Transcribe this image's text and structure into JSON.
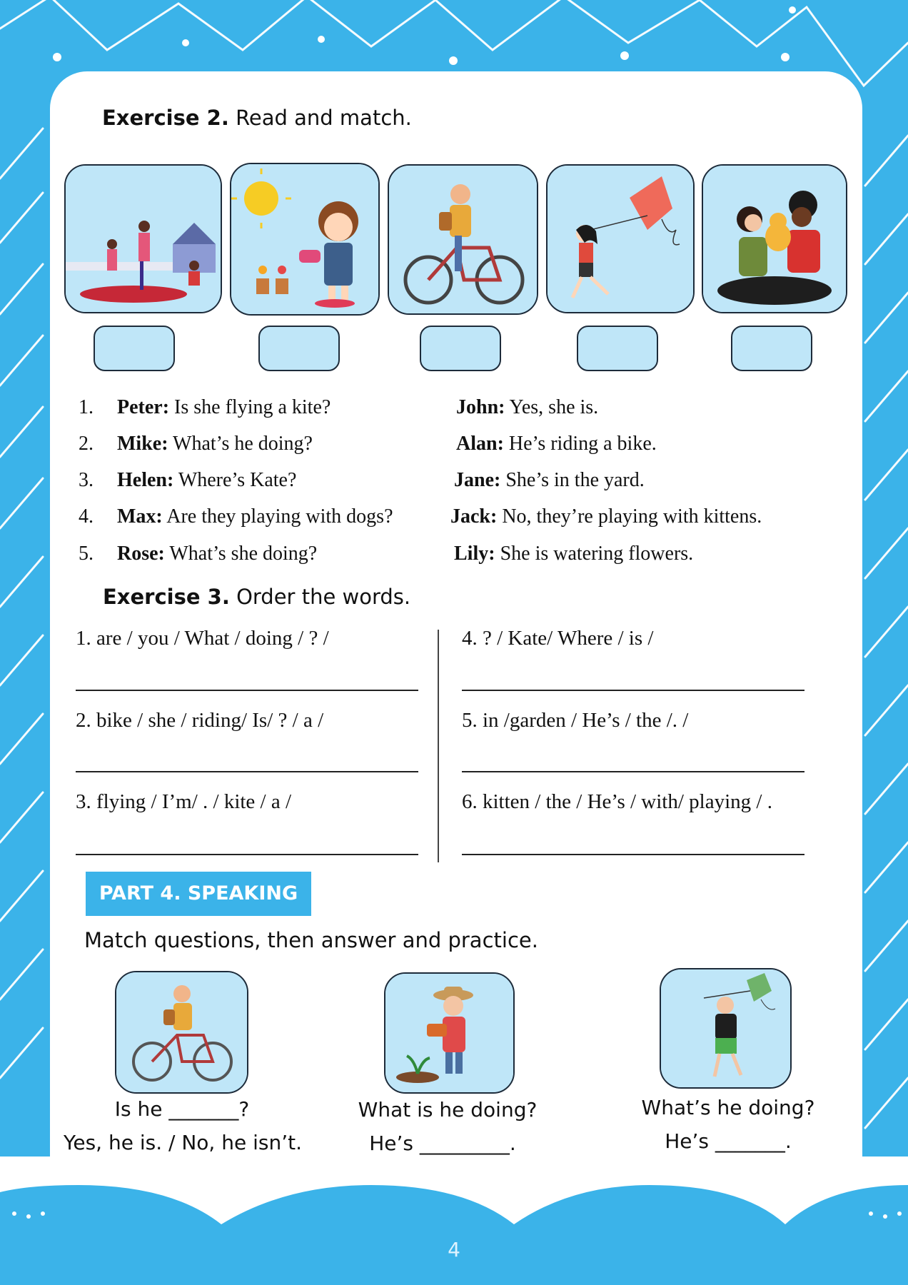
{
  "exercise2": {
    "label": "Exercise 2.",
    "instruction": "Read and match.",
    "pictures": [
      "yoga-family-picture",
      "girl-watering-flowers-picture",
      "man-riding-bike-picture",
      "girl-flying-kite-picture",
      "girls-with-kitten-picture"
    ],
    "dialogues": [
      {
        "num": "1.",
        "q_name": "Peter:",
        "q_text": "Is she flying a kite?",
        "a_name": "John:",
        "a_text": "Yes, she is."
      },
      {
        "num": "2.",
        "q_name": "Mike:",
        "q_text": "What’s he doing?",
        "a_name": "Alan:",
        "a_text": "He’s riding a bike."
      },
      {
        "num": "3.",
        "q_name": "Helen:",
        "q_text": "Where’s Kate?",
        "a_name": "Jane:",
        "a_text": "She’s in the yard."
      },
      {
        "num": "4.",
        "q_name": "Max:",
        "q_text": "Are they playing with dogs?",
        "a_name": "Jack:",
        "a_text": "No, they’re playing with kittens."
      },
      {
        "num": "5.",
        "q_name": "Rose:",
        "q_text": "What’s she doing?",
        "a_name": "Lily:",
        "a_text": "She is watering flowers."
      }
    ]
  },
  "exercise3": {
    "label": "Exercise 3.",
    "instruction": "Order the words.",
    "items": [
      "1. are / you /  What / doing / ? /",
      "2. bike / she / riding/ Is/ ? / a /",
      "3. flying / I’m/ . / kite / a /",
      "4. ? / Kate/ Where / is /",
      "5. in /garden / He’s / the  /. /",
      "6. kitten / the / He’s / with/ playing / ."
    ]
  },
  "part4": {
    "label": "PART 4. SPEAKING",
    "instruction": "Match questions, then answer and practice.",
    "cards": [
      {
        "line1": "Is he _______?",
        "line2": "Yes, he is. / No, he isn’t."
      },
      {
        "line1": "What is he doing?",
        "line2": "He’s  _________."
      },
      {
        "line1": "What’s he doing?",
        "line2": "He’s _______."
      }
    ]
  },
  "page_number": "4",
  "colors": {
    "background": "#3bb3e9",
    "picture_bg": "#bfe6f8",
    "card": "#ffffff"
  }
}
